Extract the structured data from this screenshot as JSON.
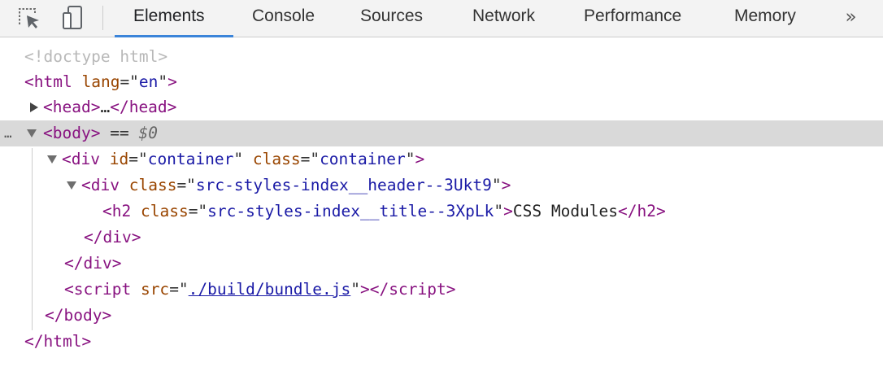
{
  "toolbar": {
    "tabs": [
      "Elements",
      "Console",
      "Sources",
      "Network",
      "Performance",
      "Memory"
    ],
    "active_tab": "Elements",
    "more_tabs_glyph": "»",
    "icons": [
      "inspect-element-icon",
      "device-toolbar-icon",
      "more-tabs-icon"
    ],
    "accent_color": "#3b84d9"
  },
  "tree": {
    "doctype": "<!doctype html>",
    "html_open": {
      "tag": "html",
      "attr": "lang",
      "value": "en"
    },
    "head": {
      "tag": "head",
      "ellipsis": "…",
      "collapsed": true
    },
    "body": {
      "tag": "body",
      "eq": "==",
      "ref": "$0",
      "selected": true,
      "dots": "…"
    },
    "container_div": {
      "tag": "div",
      "attr1": "id",
      "val1": "container",
      "attr2": "class",
      "val2": "container"
    },
    "header_div": {
      "tag": "div",
      "attr": "class",
      "value": "src-styles-index__header--3Ukt9"
    },
    "h2": {
      "tag": "h2",
      "attr": "class",
      "value": "src-styles-index__title--3XpLk",
      "text": "CSS Modules"
    },
    "script": {
      "tag": "script",
      "attr": "src",
      "value": "./build/bundle.js"
    }
  }
}
